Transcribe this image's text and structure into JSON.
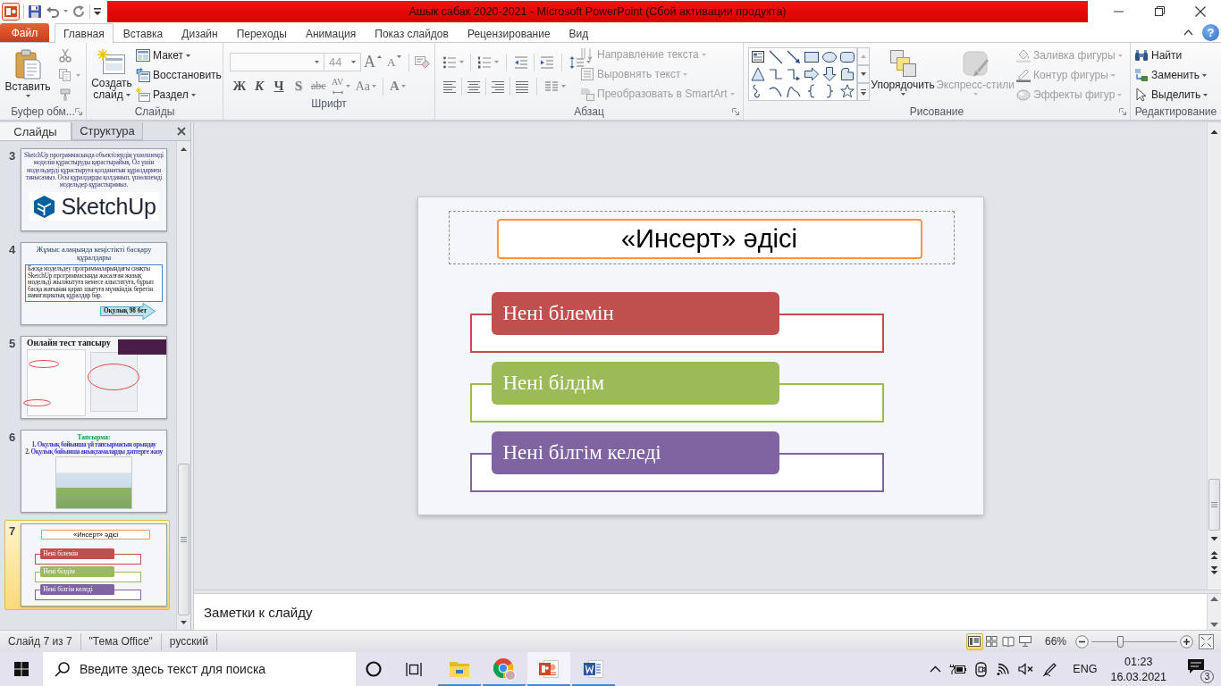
{
  "window": {
    "title": "Ашык сабак 2020-2021 - Microsoft PowerPoint (Сбой активации продукта)"
  },
  "file_tab": "Файл",
  "tabs": [
    {
      "label": "Главная",
      "selected": true
    },
    {
      "label": "Вставка",
      "selected": false
    },
    {
      "label": "Дизайн",
      "selected": false
    },
    {
      "label": "Переходы",
      "selected": false
    },
    {
      "label": "Анимация",
      "selected": false
    },
    {
      "label": "Показ слайдов",
      "selected": false
    },
    {
      "label": "Рецензирование",
      "selected": false
    },
    {
      "label": "Вид",
      "selected": false
    }
  ],
  "help": "?",
  "ribbon": {
    "clipboard": {
      "label": "Буфер обм...",
      "paste": "Вставить"
    },
    "slides": {
      "label": "Слайды",
      "new_slide": "Создать слайд",
      "buttons": [
        {
          "kind": "layout",
          "label": "Макет",
          "dropdown": true
        },
        {
          "kind": "reset",
          "label": "Восстановить",
          "dropdown": false
        },
        {
          "kind": "section",
          "label": "Раздел",
          "dropdown": true
        }
      ]
    },
    "font": {
      "label": "Шрифт",
      "font_size": "44",
      "size_buttons": [
        {
          "kind": "grow",
          "text": "A"
        },
        {
          "kind": "shrink",
          "text": "A"
        }
      ],
      "format_buttons": [
        {
          "kind": "bold",
          "text": "Ж"
        },
        {
          "kind": "italic",
          "text": "К"
        },
        {
          "kind": "underline",
          "text": "Ч"
        },
        {
          "kind": "shadow",
          "text": "S"
        },
        {
          "kind": "strikethrough",
          "text": "abc"
        },
        {
          "kind": "spacing",
          "text": "AV"
        },
        {
          "kind": "case",
          "text": "Aa"
        },
        {
          "kind": "color",
          "text": "A"
        }
      ]
    },
    "paragraph": {
      "label": "Абзац",
      "buttons": [
        {
          "kind": "text_direction",
          "label": "Направление текста",
          "disabled": true
        },
        {
          "kind": "align_text",
          "label": "Выровнять текст",
          "disabled": true
        },
        {
          "kind": "smartart",
          "label": "Преобразовать в SmartArt",
          "disabled": true
        }
      ]
    },
    "drawing": {
      "label": "Рисование",
      "large_buttons": [
        {
          "kind": "arrange",
          "label": "Упорядочить",
          "disabled": false
        },
        {
          "kind": "quick_styles",
          "label": "Экспресс-стили",
          "disabled": true
        }
      ],
      "buttons": [
        {
          "kind": "fill",
          "label": "Заливка фигуры",
          "disabled": true
        },
        {
          "kind": "outline",
          "label": "Контур фигуры",
          "disabled": true
        },
        {
          "kind": "effects",
          "label": "Эффекты фигур",
          "disabled": true
        }
      ]
    },
    "editing": {
      "label": "Редактирование",
      "buttons": [
        {
          "kind": "find",
          "label": "Найти",
          "dropdown": false
        },
        {
          "kind": "replace",
          "label": "Заменить",
          "dropdown": true
        },
        {
          "kind": "select",
          "label": "Выделить",
          "dropdown": true
        }
      ]
    }
  },
  "slide_panel": {
    "tabs": [
      {
        "label": "Слайды",
        "selected": true
      },
      {
        "label": "Структура",
        "selected": false
      }
    ],
    "thumbnails": [
      {
        "number": "3",
        "selected": false,
        "kind": "text_logo",
        "text": "SketchUp программасында объектілердің үшөлшемді моделін құрастыруды қарастырайық. Ол үшін модельдерді құрастыруға қолданатын құралдармен танысамыз. Осы құралдарды қолданып, үшөлшемді модельдер құрастырамыз.",
        "logo": "SketchUp"
      },
      {
        "number": "4",
        "selected": false,
        "kind": "text_box",
        "title": "Жұмыс алаңында кеңістікті басқару құралдары",
        "text": "Басқа модельдеу программаларындағы сияқты SketchUp программасында жасалған жазық модельді жылжытуға немесе алыстатуға, бұрып басқа жағынан қарап шығуға мүмкіндік беретін навигациялық құралдар бар.",
        "arrow": "Оқулық 98 бет"
      },
      {
        "number": "5",
        "selected": false,
        "kind": "images",
        "title": "Онлайн тест тапсыру"
      },
      {
        "number": "6",
        "selected": false,
        "kind": "task",
        "title": "Тапсырма:",
        "lines": [
          "1. Оқулық бойынша үй тапсырмасын орындау",
          "2. Оқулық бойынша анықтамаларды дәптерге жазу"
        ]
      },
      {
        "number": "7",
        "selected": true,
        "kind": "insert",
        "title": "«Инсерт» әдісі",
        "items": [
          {
            "label": "Нені білемін",
            "color": "#c0504d"
          },
          {
            "label": "Нені білдім",
            "color": "#9bbb59"
          },
          {
            "label": "Нені білгім келеді",
            "color": "#8064a2"
          }
        ]
      }
    ]
  },
  "slide": {
    "title": "«Инсерт» әдісі",
    "items": [
      {
        "label": "Нені білемін",
        "color": "#c0504d"
      },
      {
        "label": "Нені білдім",
        "color": "#9bbb59"
      },
      {
        "label": "Нені білгім келеді",
        "color": "#8064a2"
      }
    ]
  },
  "notes": {
    "placeholder": "Заметки к слайду"
  },
  "status_bar": {
    "slide": "Слайд 7 из 7",
    "theme": "\"Тема Office\"",
    "language": "русский",
    "views": [
      {
        "kind": "normal",
        "selected": true
      },
      {
        "kind": "sorter",
        "selected": false
      },
      {
        "kind": "reading",
        "selected": false
      },
      {
        "kind": "slideshow",
        "selected": false
      }
    ],
    "zoom": "66%",
    "zoom_slider": {
      "level": 0.33
    }
  },
  "taskbar": {
    "search": {
      "placeholder": "Введите здесь текст для поиска"
    },
    "apps": [
      {
        "kind": "folder",
        "selected": false
      },
      {
        "kind": "browser",
        "selected": false
      },
      {
        "kind": "presentation",
        "selected": true
      },
      {
        "kind": "document",
        "selected": false
      }
    ],
    "language": "ENG",
    "time": "01:23",
    "date": "16.03.2021",
    "notifications": "3"
  }
}
